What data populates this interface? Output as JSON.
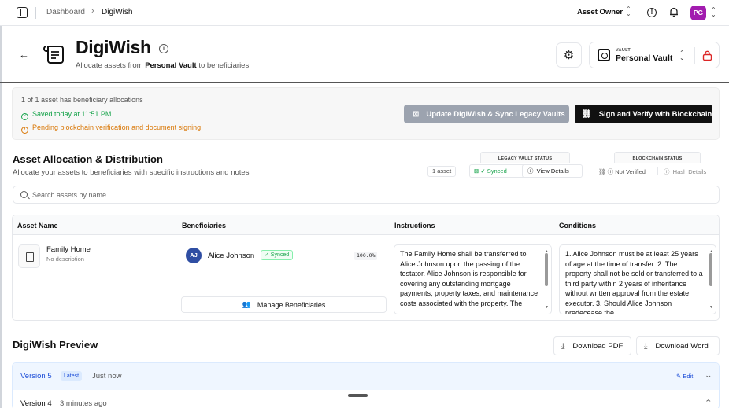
{
  "breadcrumb": {
    "root": "Dashboard",
    "current": "DigiWish"
  },
  "topbar": {
    "role": "Asset Owner",
    "avatar_initials": "PG",
    "avatar_color": "#a21caf"
  },
  "header": {
    "title": "DigiWish",
    "subtitle_prefix": "Allocate assets from",
    "subtitle_vault": "Personal Vault",
    "subtitle_suffix": "to beneficiaries"
  },
  "vault_selector": {
    "caption": "VAULT",
    "name": "Personal Vault"
  },
  "status": {
    "allocation_summary": "1 of 1 asset has beneficiary allocations",
    "saved": "Saved today at 11:51 PM",
    "pending": "Pending blockchain verification and document signing",
    "update_button": "Update DigiWish & Sync Legacy Vaults",
    "sign_button": "Sign and Verify with Blockchain",
    "saved_color": "#16a34a",
    "pending_color": "#d97706"
  },
  "allocation": {
    "title": "Asset Allocation & Distribution",
    "subtitle": "Allocate your assets to beneficiaries with specific instructions and notes",
    "asset_count": "1 asset",
    "legacy_vault_status_label": "LEGACY VAULT STATUS",
    "legacy_synced": "Synced",
    "view_details": "View Details",
    "blockchain_status_label": "BLOCKCHAIN STATUS",
    "not_verified": "Not Verified",
    "hash_details": "Hash Details",
    "search_placeholder": "Search assets by name"
  },
  "table": {
    "columns": [
      "Asset Name",
      "Beneficiaries",
      "Instructions",
      "Conditions"
    ],
    "rows": [
      {
        "asset_name": "Family Home",
        "description": "No description",
        "beneficiary": {
          "initials": "AJ",
          "name": "Alice Johnson",
          "status": "✓ Synced",
          "percent": "100.0%"
        },
        "manage_button": "Manage Beneficiaries",
        "instructions": "The Family Home shall be transferred to Alice Johnson upon the passing of the testator. Alice Johnson is responsible for covering any outstanding mortgage payments, property taxes, and maintenance costs associated with the property. The",
        "conditions": "1. Alice Johnson must be at least 25 years of age at the time of transfer. 2. The property shall not be sold or transferred to a third party within 2 years of inheritance without written approval from the estate executor. 3. Should Alice Johnson predecease the"
      }
    ]
  },
  "preview": {
    "title": "DigiWish Preview",
    "download_pdf": "Download PDF",
    "download_word": "Download Word",
    "versions": [
      {
        "label": "Version 5",
        "badge": "Latest",
        "time": "Just now",
        "edit": "Edit"
      },
      {
        "label": "Version 4",
        "time": "3 minutes ago"
      }
    ]
  }
}
